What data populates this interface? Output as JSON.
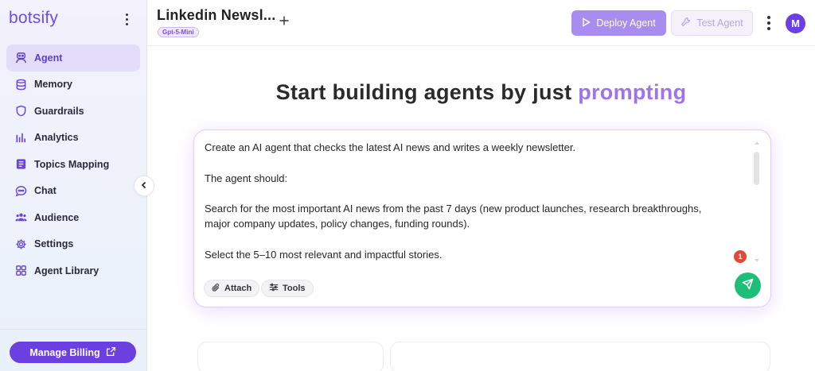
{
  "sidebar": {
    "brand": "botsify",
    "items": [
      {
        "label": "Agent",
        "icon": "robot-icon",
        "active": true
      },
      {
        "label": "Memory",
        "icon": "database-icon",
        "active": false
      },
      {
        "label": "Guardrails",
        "icon": "shield-icon",
        "active": false
      },
      {
        "label": "Analytics",
        "icon": "bar-chart-icon",
        "active": false
      },
      {
        "label": "Topics Mapping",
        "icon": "document-icon",
        "active": false
      },
      {
        "label": "Chat",
        "icon": "chat-bubble-icon",
        "active": false
      },
      {
        "label": "Audience",
        "icon": "users-icon",
        "active": false
      },
      {
        "label": "Settings",
        "icon": "gear-icon",
        "active": false
      },
      {
        "label": "Agent Library",
        "icon": "grid-icon",
        "active": false
      }
    ],
    "billing_label": "Manage Billing"
  },
  "header": {
    "title": "Linkedin Newsl...",
    "model_badge": "Gpt-5-Mini",
    "deploy_label": "Deploy Agent",
    "test_label": "Test Agent",
    "avatar_initial": "M"
  },
  "main": {
    "headline_prefix": "Start building agents by just",
    "headline_accent": "prompting",
    "prompt_lines": [
      "Create an AI agent that checks the latest AI news and writes a weekly newsletter.",
      "",
      "The agent should:",
      "",
      "Search for the most important AI news from the past 7 days (new product launches, research breakthroughs,",
      "major company updates, policy changes, funding rounds).",
      "",
      "Select the 5–10 most relevant and impactful stories."
    ],
    "notification_count": "1",
    "attach_label": "Attach",
    "tools_label": "Tools"
  },
  "colors": {
    "brand": "#6c4fd6",
    "accent": "#a074e8",
    "billing": "#6b3fe0",
    "send": "#1dbf77",
    "badge": "#e04a3a"
  }
}
